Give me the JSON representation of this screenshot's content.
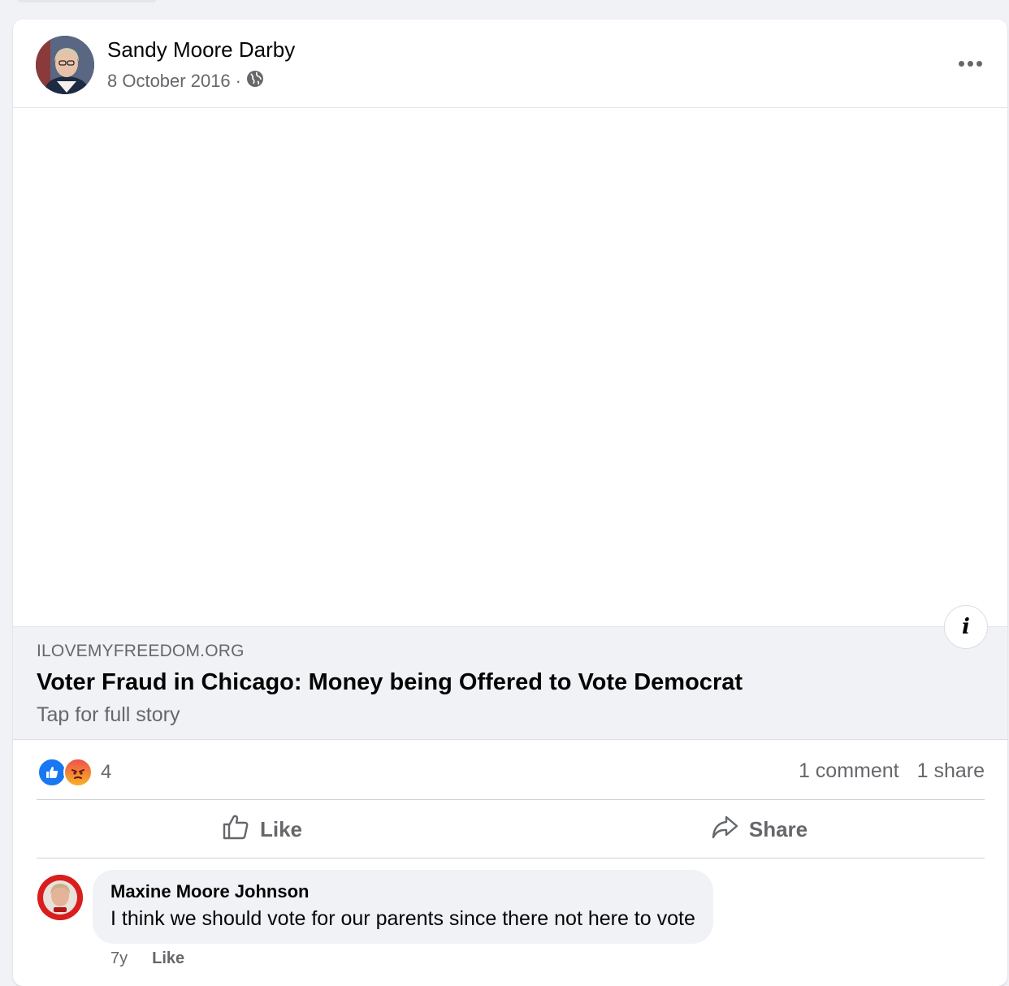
{
  "post": {
    "author": "Sandy Moore Darby",
    "date": "8 October 2016",
    "separator": "·",
    "privacy_icon": "globe-icon",
    "more_icon": "more-options-icon"
  },
  "link_preview": {
    "domain": "ILOVEMYFREEDOM.ORG",
    "title": "Voter Fraud in Chicago: Money being Offered to Vote Democrat",
    "subtitle": "Tap for full story",
    "info_icon": "info-icon"
  },
  "stats": {
    "reaction_count": "4",
    "reactions": [
      "like",
      "angry"
    ],
    "comments": "1 comment",
    "shares": "1 share"
  },
  "actions": {
    "like_label": "Like",
    "share_label": "Share"
  },
  "comment": {
    "author": "Maxine Moore Johnson",
    "text": "I think we should vote for our parents since there not here to vote",
    "age": "7y",
    "like_label": "Like"
  },
  "colors": {
    "like_blue": "#1877f2",
    "secondary_text": "#65676b",
    "background": "#f0f2f5"
  }
}
